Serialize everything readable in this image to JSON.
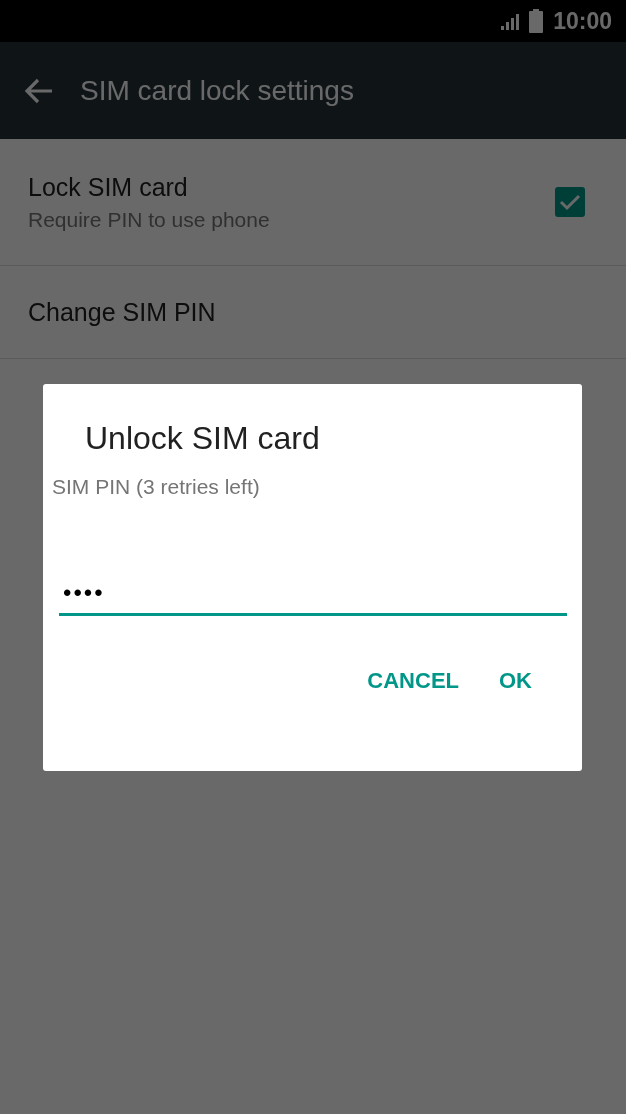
{
  "status_bar": {
    "time": "10:00"
  },
  "toolbar": {
    "title": "SIM card lock settings"
  },
  "settings": [
    {
      "kind": "checkbox",
      "title": "Lock SIM card",
      "summary": "Require PIN to use phone",
      "checked": true
    },
    {
      "kind": "plain",
      "title": "Change SIM PIN"
    }
  ],
  "dialog": {
    "title": "Unlock SIM card",
    "message": "SIM PIN (3 retries left)",
    "pin_field": {
      "value": "••••"
    },
    "buttons": [
      "CANCEL",
      "OK"
    ]
  }
}
